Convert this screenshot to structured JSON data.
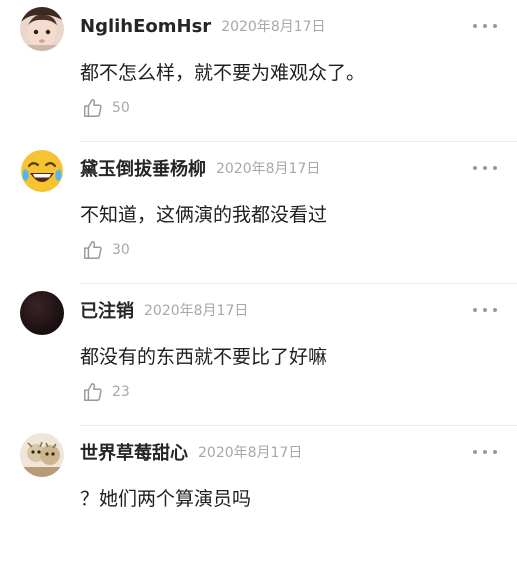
{
  "comments": [
    {
      "username": "NglihEomHsr",
      "date": "2020年8月17日",
      "text": "都不怎么样，就不要为难观众了。",
      "likes": "50",
      "avatar_icon": "child-photo-avatar"
    },
    {
      "username": "黛玉倒拔垂杨柳",
      "date": "2020年8月17日",
      "text": "不知道，这俩演的我都没看过",
      "likes": "30",
      "avatar_icon": "laughing-crying-emoji-avatar"
    },
    {
      "username": "已注销",
      "date": "2020年8月17日",
      "text": "都没有的东西就不要比了好嘛",
      "likes": "23",
      "avatar_icon": "dark-default-avatar"
    },
    {
      "username": "世界草莓甜心",
      "date": "2020年8月17日",
      "text": "？她们两个算演员吗",
      "likes": "",
      "avatar_icon": "cartoon-photo-avatar"
    }
  ],
  "colors": {
    "username": "#262626",
    "meta": "#a8a8a8",
    "text": "#1f1f1f",
    "divider": "#ececec"
  }
}
